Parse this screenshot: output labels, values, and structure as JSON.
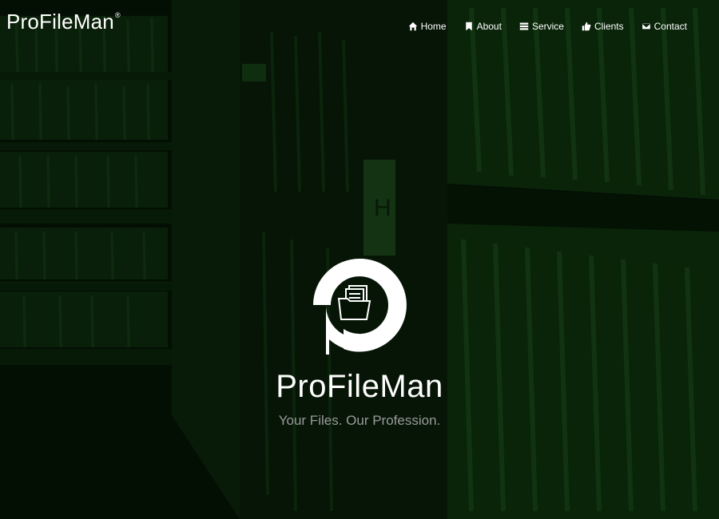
{
  "brand": {
    "name": "ProFileMan",
    "registered_mark": "®"
  },
  "nav": {
    "items": [
      {
        "label": "Home",
        "icon": "home-icon"
      },
      {
        "label": "About",
        "icon": "bookmark-icon"
      },
      {
        "label": "Service",
        "icon": "list-icon"
      },
      {
        "label": "Clients",
        "icon": "thumbs-up-icon"
      },
      {
        "label": "Contact",
        "icon": "envelope-icon"
      }
    ]
  },
  "hero": {
    "title": "ProFileMan",
    "tagline": "Your Files. Our Profession.",
    "logo_icon": "folder-with-files-icon",
    "background": "file-archive-shelves-photo"
  },
  "colors": {
    "overlay": "#041204",
    "text": "#ffffff",
    "tagline": "#9a9a9a"
  }
}
